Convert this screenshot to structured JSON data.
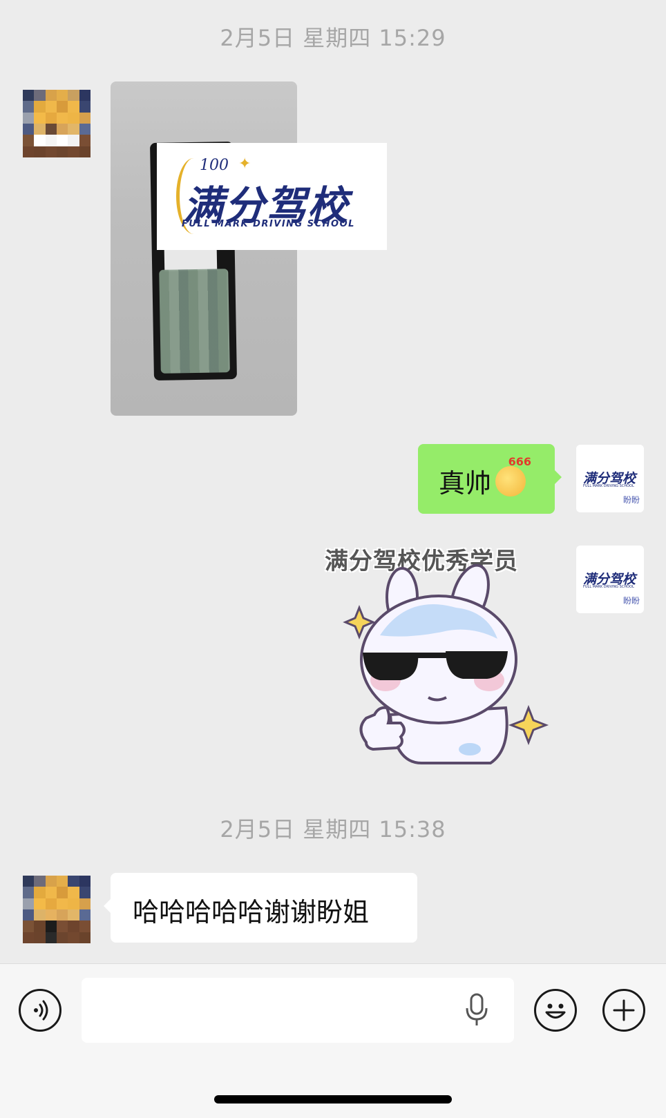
{
  "timestamps": {
    "first": "2月5日 星期四 15:29",
    "second": "2月5日 星期四 15:38"
  },
  "messages": {
    "image_logo": {
      "title": "满分驾校",
      "subtitle": "FULL MARK DRIVING SCHOOL",
      "badge": "100"
    },
    "sent_text": "真帅",
    "sent_emoji": {
      "name": "666-emoji",
      "label": "666"
    },
    "sticker_caption": "满分驾校优秀学员",
    "received_text": "哈哈哈哈哈谢谢盼姐"
  },
  "self_avatar": {
    "title": "满分驾校",
    "subtitle": "FULL MARK DRIVING SCHOOL",
    "name": "盼盼"
  },
  "input_bar": {
    "placeholder": "",
    "icons": [
      "voice-icon",
      "mic-icon",
      "emoji-icon",
      "plus-icon"
    ]
  },
  "colors": {
    "chat_bg": "#ececec",
    "sent_bubble": "#95ec69",
    "received_bubble": "#ffffff",
    "brand_navy": "#1f2d7a",
    "brand_gold": "#e5b12a"
  }
}
